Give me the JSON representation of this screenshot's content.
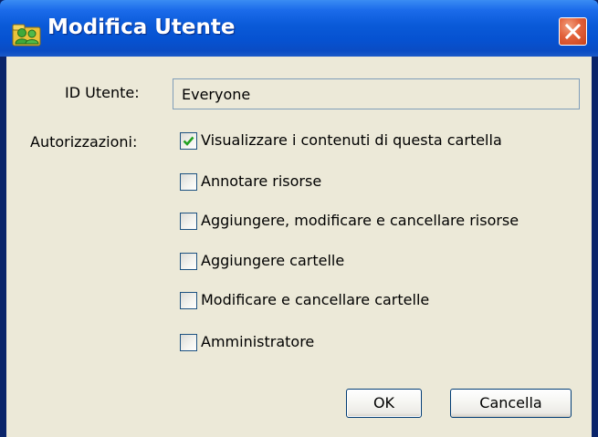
{
  "window": {
    "title": "Modifica Utente",
    "icon": "users-folder-icon",
    "close_icon": "close-icon",
    "accent_color": "#0a5ad8",
    "close_color": "#e2613a"
  },
  "form": {
    "user_id_label": "ID Utente:",
    "user_id_value": "Everyone",
    "permissions_label": "Autorizzazioni:",
    "permissions": [
      {
        "label": "Visualizzare i contenuti di questa cartella",
        "checked": true
      },
      {
        "label": "Annotare risorse",
        "checked": false
      },
      {
        "label": "Aggiungere, modificare e cancellare risorse",
        "checked": false
      },
      {
        "label": "Aggiungere cartelle",
        "checked": false
      },
      {
        "label": "Modificare e cancellare cartelle",
        "checked": false
      },
      {
        "label": "Amministratore",
        "checked": false
      }
    ]
  },
  "buttons": {
    "ok_label": "OK",
    "cancel_label": "Cancella"
  }
}
